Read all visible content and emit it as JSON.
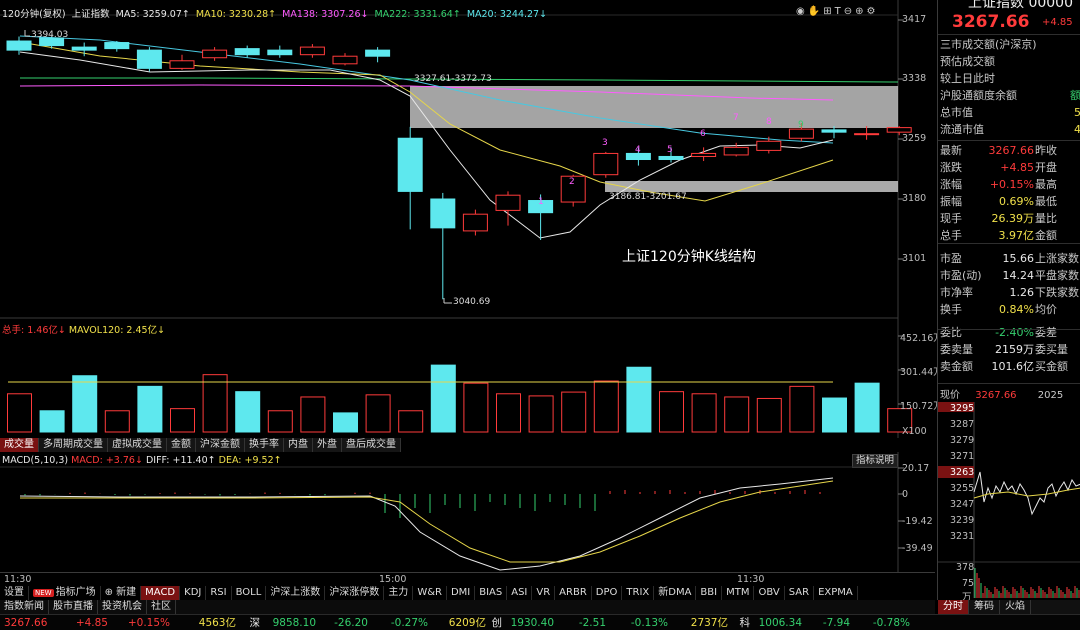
{
  "chart_header": {
    "period": "120分钟(复权)",
    "name": "上证指数",
    "ma5": "MA5: 3259.07↑",
    "ma10": "MA10: 3230.28↑",
    "ma138": "MA138: 3307.26↓",
    "ma222": "MA222: 3331.64↑",
    "ma20": "MA20: 3244.27↓"
  },
  "price_axis": [
    "3417",
    "3338",
    "3259",
    "3180",
    "3101"
  ],
  "annotations": {
    "high": "3394.03",
    "low": "3040.69",
    "upper_zone": "3327.61-3372.73",
    "lower_zone": "3186.81-3201.67",
    "title": "上证120分钟K线结构",
    "counts": [
      "1",
      "2",
      "3",
      "4",
      "5",
      "6",
      "7",
      "8",
      "9"
    ]
  },
  "colors": {
    "up": "#ff3b3b",
    "down": "#5ee8ee",
    "ma5": "#e8e8e8",
    "ma10": "#e6d64a",
    "ma20": "#ff5cff",
    "ma138": "#48c8e0",
    "ma222": "#35d06e",
    "zone": "#bdbdbd"
  },
  "volume": {
    "header_total": "总手: 1.46亿↓",
    "header_mavol": "MAVOL120: 2.45亿↓",
    "axis": [
      "452.16万",
      "301.44万",
      "150.72万",
      "X100"
    ],
    "tabs": [
      "成交量",
      "多周期成交量",
      "虚拟成交量",
      "金额",
      "沪深金额",
      "换手率",
      "内盘",
      "外盘",
      "盘后成交量"
    ]
  },
  "macd": {
    "header": "MACD(5,10,3)",
    "macd_val": "MACD: +3.76↓",
    "diff_val": "DIFF: +11.40↑",
    "dea_val": "DEA: +9.52↑",
    "axis": [
      "20.17",
      "0",
      "-19.42",
      "-39.49"
    ],
    "button": "指标说明"
  },
  "time_axis": [
    "11:30",
    "15:00",
    "11:30"
  ],
  "bottom_tabs": [
    "设置",
    "指标广场",
    "新建",
    "MACD",
    "KDJ",
    "RSI",
    "BOLL",
    "沪深上涨数",
    "沪深涨停数",
    "主力",
    "W&R",
    "DMI",
    "BIAS",
    "ASI",
    "VR",
    "ARBR",
    "DPO",
    "TRIX",
    "新DMA",
    "BBI",
    "MTM",
    "OBV",
    "SAR",
    "EXPMA"
  ],
  "new_badge": "NEW",
  "status_tabs": [
    "指数新闻",
    "股市直播",
    "投资机会",
    "社区"
  ],
  "ticker": {
    "sh_price": "3267.66",
    "sh_chg": "+4.85",
    "sh_pct": "+0.15%",
    "sh_amt": "4563亿",
    "sz_label": "深",
    "sz_price": "9858.10",
    "sz_chg": "-26.20",
    "sz_pct": "-0.27%",
    "sz_amt": "6209亿",
    "cy_label": "创",
    "cy_price": "1930.40",
    "cy_chg": "-2.51",
    "cy_pct": "-0.13%",
    "cy_amt": "2737亿",
    "kc_label": "科",
    "kc_price": "1006.34",
    "kc_chg": "-7.94",
    "kc_pct": "-0.78%"
  },
  "right_panel": {
    "title": "上证指数 00000",
    "price": "3267.66",
    "change": "+4.85",
    "rows": [
      {
        "label": "三市成交额(沪深京)",
        "value": ""
      },
      {
        "label": "预估成交额",
        "value": ""
      },
      {
        "label": "较上日此时",
        "value": ""
      },
      {
        "label": "沪股通额度余额",
        "value": "额"
      },
      {
        "label": "总市值",
        "value": "5"
      },
      {
        "label": "流通市值",
        "value": "4"
      }
    ],
    "quote": [
      {
        "l1": "最新",
        "v1": "3267.66",
        "c1": "red",
        "l2": "昨收"
      },
      {
        "l1": "涨跌",
        "v1": "+4.85",
        "c1": "red",
        "l2": "开盘"
      },
      {
        "l1": "涨幅",
        "v1": "+0.15%",
        "c1": "red",
        "l2": "最高"
      },
      {
        "l1": "振幅",
        "v1": "0.69%",
        "c1": "yellow",
        "l2": "最低"
      },
      {
        "l1": "现手",
        "v1": "26.39万",
        "c1": "yellow",
        "l2": "量比"
      },
      {
        "l1": "总手",
        "v1": "3.97亿",
        "c1": "yellow",
        "l2": "金额"
      },
      {
        "l1": "市盈",
        "v1": "15.66",
        "c1": "white",
        "l2": "上涨家数"
      },
      {
        "l1": "市盈(动)",
        "v1": "14.24",
        "c1": "white",
        "l2": "平盘家数"
      },
      {
        "l1": "市净率",
        "v1": "1.26",
        "c1": "white",
        "l2": "下跌家数"
      },
      {
        "l1": "换手",
        "v1": "0.84%",
        "c1": "yellow",
        "l2": "均价"
      },
      {
        "l1": "委比",
        "v1": "-2.40%",
        "c1": "green",
        "l2": "委差"
      },
      {
        "l1": "委卖量",
        "v1": "2159万",
        "c1": "white",
        "l2": "委买量"
      },
      {
        "l1": "卖金额",
        "v1": "101.6亿",
        "c1": "white",
        "l2": "买金额"
      }
    ],
    "mini_header": {
      "label": "现价",
      "price": "3267.66",
      "year": "2025"
    },
    "mini_axis": [
      "3295",
      "3287",
      "3279",
      "3271",
      "3263",
      "3255",
      "3247",
      "3239",
      "3231"
    ],
    "mini_vol": [
      "378",
      "75"
    ],
    "mini_vol_unit": "万",
    "tabs": [
      "分时",
      "筹码",
      "火焰"
    ]
  }
}
